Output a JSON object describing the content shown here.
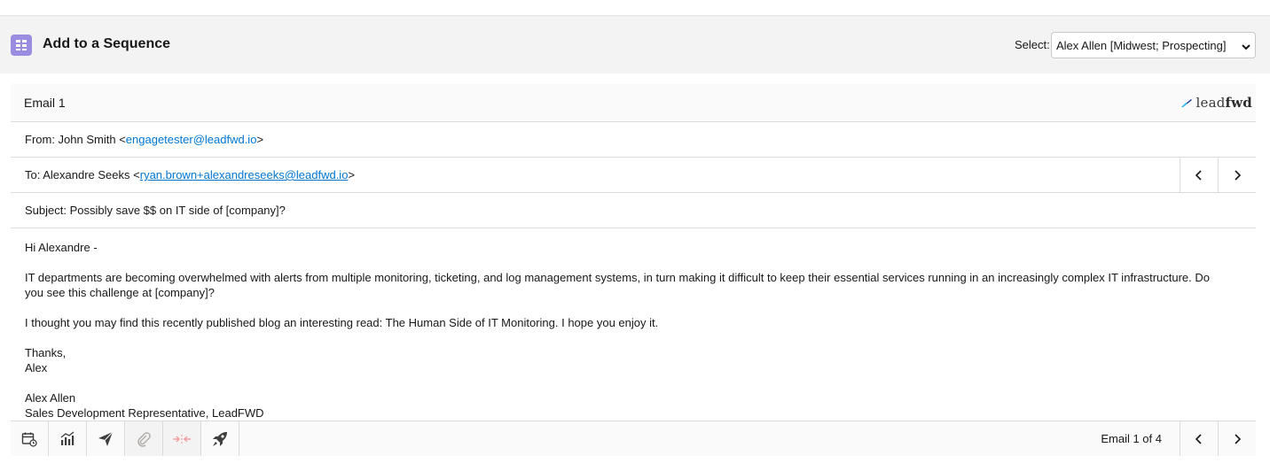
{
  "header": {
    "title": "Add to a Sequence",
    "select_label": "Select:",
    "select_value": "Alex Allen [Midwest; Prospecting]"
  },
  "email": {
    "title": "Email 1",
    "logo_light": "lead",
    "logo_bold": "fwd",
    "from_prefix": "From: John Smith <",
    "from_email": "engagetester@leadfwd.io",
    "from_suffix": ">",
    "to_prefix": "To: Alexandre Seeks <",
    "to_email": "ryan.brown+alexandreseeks@leadfwd.io",
    "to_suffix": ">",
    "subject": "Subject: Possibly save $$ on IT side of [company]?",
    "body": {
      "greeting": "Hi Alexandre -",
      "p1": "IT departments are becoming overwhelmed with alerts from multiple monitoring, ticketing, and log management systems, in turn making it difficult to keep their essential services running in an increasingly complex IT infrastructure. Do you see this challenge at [company]?",
      "p2": "I thought you may find this recently published blog an interesting read: The Human Side of IT Monitoring. I hope you enjoy it.",
      "closing": "Thanks,",
      "closing_name": "Alex",
      "sig_name": "Alex Allen",
      "sig_title": "Sales Development Representative, LeadFWD"
    }
  },
  "footer": {
    "counter": "Email 1 of 4"
  },
  "colors": {
    "accent": "#9a8ce0",
    "link": "#0176d3",
    "border": "#dddbda"
  }
}
